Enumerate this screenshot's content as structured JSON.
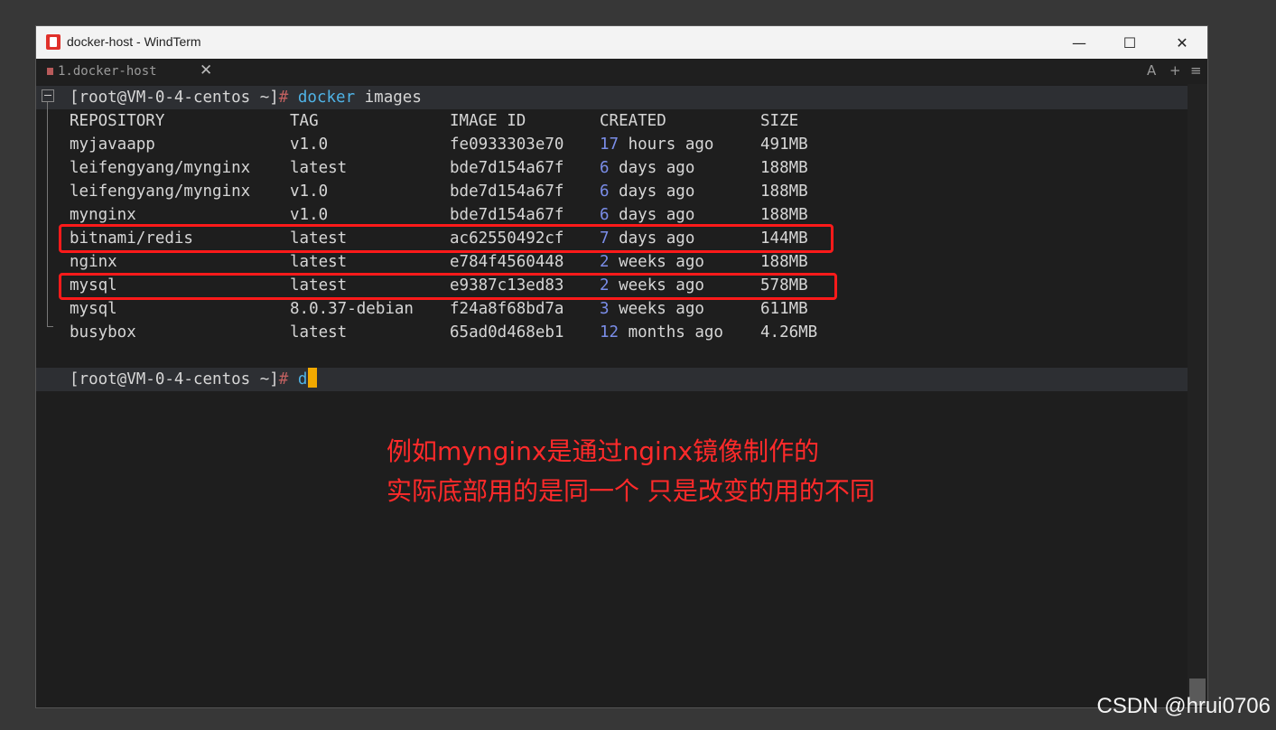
{
  "window": {
    "title": "docker-host - WindTerm"
  },
  "tab": {
    "label": "1.docker-host",
    "close_glyph": "✕"
  },
  "tab_tools": {
    "font": "A",
    "add": "+",
    "menu": "≡"
  },
  "controls": {
    "minimize": "—",
    "maximize": "☐",
    "close": "✕"
  },
  "terminal": {
    "prompt": "[root@VM-0-4-centos ~]",
    "hash": "#",
    "command_name": "docker",
    "command_args": " images",
    "headers": [
      "REPOSITORY",
      "TAG",
      "IMAGE ID",
      "CREATED",
      "SIZE"
    ],
    "rows": [
      {
        "repo": "myjavaapp",
        "tag": "v1.0",
        "id": "fe0933303e70",
        "created_num": "17",
        "created_rest": " hours ago",
        "size": "491MB"
      },
      {
        "repo": "leifengyang/mynginx",
        "tag": "latest",
        "id": "bde7d154a67f",
        "created_num": "6",
        "created_rest": " days ago",
        "size": "188MB"
      },
      {
        "repo": "leifengyang/mynginx",
        "tag": "v1.0",
        "id": "bde7d154a67f",
        "created_num": "6",
        "created_rest": " days ago",
        "size": "188MB"
      },
      {
        "repo": "mynginx",
        "tag": "v1.0",
        "id": "bde7d154a67f",
        "created_num": "6",
        "created_rest": " days ago",
        "size": "188MB"
      },
      {
        "repo": "bitnami/redis",
        "tag": "latest",
        "id": "ac62550492cf",
        "created_num": "7",
        "created_rest": " days ago",
        "size": "144MB"
      },
      {
        "repo": "nginx",
        "tag": "latest",
        "id": "e784f4560448",
        "created_num": "2",
        "created_rest": " weeks ago",
        "size": "188MB"
      },
      {
        "repo": "mysql",
        "tag": "latest",
        "id": "e9387c13ed83",
        "created_num": "2",
        "created_rest": " weeks ago",
        "size": "578MB"
      },
      {
        "repo": "mysql",
        "tag": "8.0.37-debian",
        "id": "f24a8f68bd7a",
        "created_num": "3",
        "created_rest": " weeks ago",
        "size": "611MB"
      },
      {
        "repo": "busybox",
        "tag": "latest",
        "id": "65ad0d468eb1",
        "created_num": "12",
        "created_rest": " months ago",
        "size": "4.26MB"
      }
    ],
    "input": "d",
    "cursor_color": "#f2a900"
  },
  "annotation": {
    "line1": "例如mynginx是通过nginx镜像制作的",
    "line2": "实际底部用的是同一个  只是改变的用的不同",
    "color": "#ff2a2a"
  },
  "watermark": "CSDN @hrui0706"
}
